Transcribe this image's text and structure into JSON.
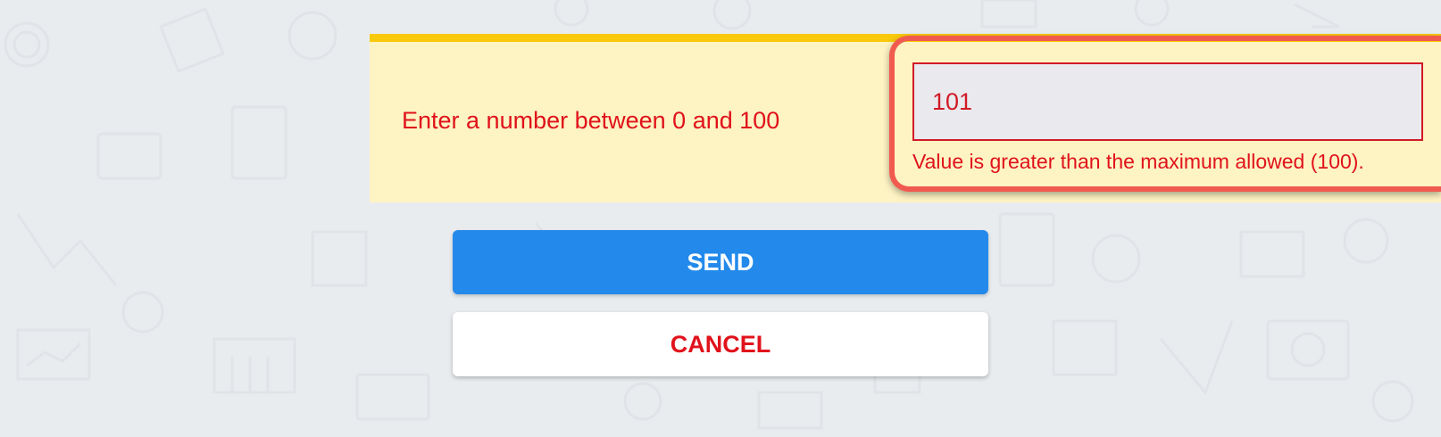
{
  "question": {
    "label": "Enter a number between 0 and 100"
  },
  "input": {
    "value": "101"
  },
  "validation": {
    "error": "Value is greater than the maximum allowed (100)."
  },
  "buttons": {
    "send_label": "SEND",
    "cancel_label": "CANCEL"
  },
  "colors": {
    "background": "#e9ecef",
    "card_background": "#fdf3c3",
    "card_accent": "#f9c90c",
    "error_red": "#e0121b",
    "highlight": "#f05a4f",
    "primary_blue": "#238aeb"
  }
}
